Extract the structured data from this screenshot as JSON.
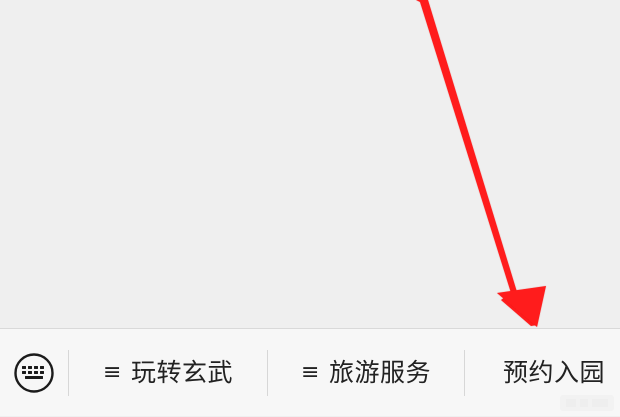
{
  "screen": {
    "background_color": "#efefef"
  },
  "annotation": {
    "arrow_color": "#ff1a1a",
    "meaning": "pointing to reservation entry"
  },
  "menu_bar": {
    "keyboard_icon": "keyboard-icon",
    "items": [
      {
        "icon": "menu-lines-icon",
        "icon_glyph": "≡",
        "label": "玩转玄武"
      },
      {
        "icon": "menu-lines-icon",
        "icon_glyph": "≡",
        "label": "旅游服务"
      },
      {
        "label": "预约入园"
      }
    ]
  }
}
